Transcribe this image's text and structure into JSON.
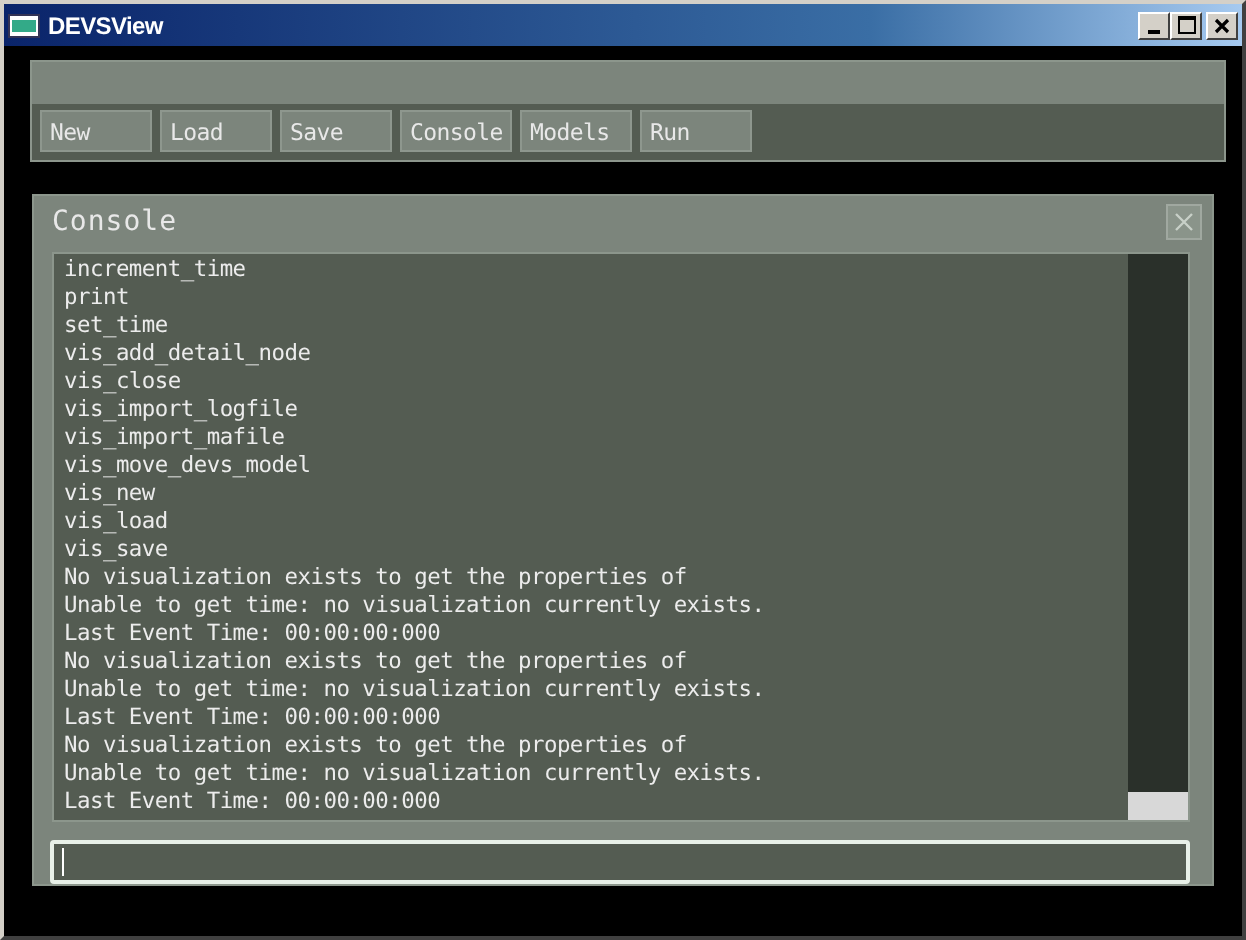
{
  "window": {
    "title": "DEVSView"
  },
  "toolbar": {
    "buttons": [
      "New",
      "Load",
      "Save",
      "Console",
      "Models",
      "Run"
    ]
  },
  "console": {
    "title": "Console",
    "lines": [
      "increment_time",
      "print",
      "set_time",
      "vis_add_detail_node",
      "vis_close",
      "vis_import_logfile",
      "vis_import_mafile",
      "vis_move_devs_model",
      "vis_new",
      "vis_load",
      "vis_save",
      "No visualization exists to get the properties of",
      "Unable to get time: no visualization currently exists.",
      "Last Event Time: 00:00:00:000",
      "No visualization exists to get the properties of",
      "Unable to get time: no visualization currently exists.",
      "Last Event Time: 00:00:00:000",
      "No visualization exists to get the properties of",
      "Unable to get time: no visualization currently exists.",
      "Last Event Time: 00:00:00:000"
    ]
  }
}
